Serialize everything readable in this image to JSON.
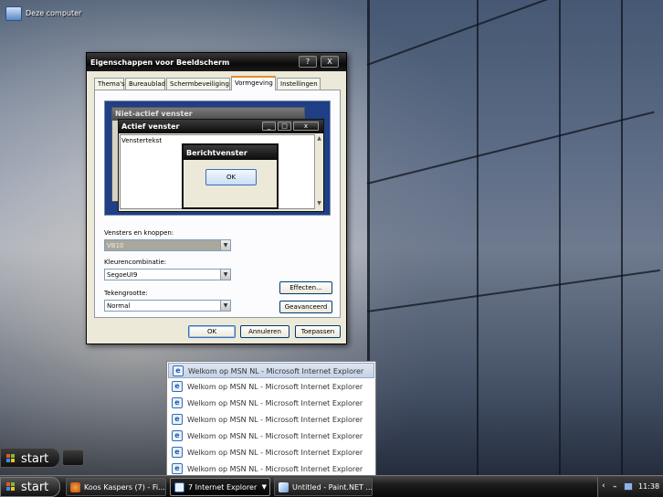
{
  "desktop": {
    "icon_label": "Deze computer"
  },
  "dialog": {
    "title": "Eigenschappen voor Beeldscherm",
    "help_btn": "?",
    "close_btn": "X",
    "tabs": [
      "Thema's",
      "Bureaublad",
      "Schermbeveiliging",
      "Vormgeving",
      "Instellingen"
    ],
    "active_tab": "Vormgeving",
    "preview": {
      "inactive_title": "Niet-actief venster",
      "active_title": "Actief venster",
      "window_text": "Venstertekst",
      "message_title": "Berichtvenster",
      "message_ok": "OK"
    },
    "windows_buttons_label": "Vensters en knoppen:",
    "windows_buttons_value": "VB10",
    "color_scheme_label": "Kleurencombinatie:",
    "color_scheme_value": "SegoeUI9",
    "font_size_label": "Tekengrootte:",
    "font_size_value": "Normal",
    "effects_btn": "Effecten...",
    "advanced_btn": "Geavanceerd",
    "ok_btn": "OK",
    "cancel_btn": "Annuleren",
    "apply_btn": "Toepassen"
  },
  "group_popup": {
    "items": [
      "Welkom op MSN NL - Microsoft Internet Explorer",
      "Welkom op MSN NL - Microsoft Internet Explorer",
      "Welkom op MSN NL - Microsoft Internet Explorer",
      "Welkom op MSN NL - Microsoft Internet Explorer",
      "Welkom op MSN NL - Microsoft Internet Explorer",
      "Welkom op MSN NL - Microsoft Internet Explorer",
      "Welkom op MSN NL - Microsoft Internet Explorer"
    ],
    "selected_index": 0
  },
  "taskbar": {
    "start_label": "start",
    "ghost_start_label": "start",
    "tasks": [
      {
        "label": "Koos Kaspers (7) - Fi...",
        "icon": "firefox-icon"
      },
      {
        "label": "7 Internet Explorer",
        "icon": "ie-icon"
      },
      {
        "label": "Untitled - Paint.NET ...",
        "icon": "paint-icon"
      }
    ],
    "tray_chevron": "‹",
    "clock": "11:38"
  }
}
